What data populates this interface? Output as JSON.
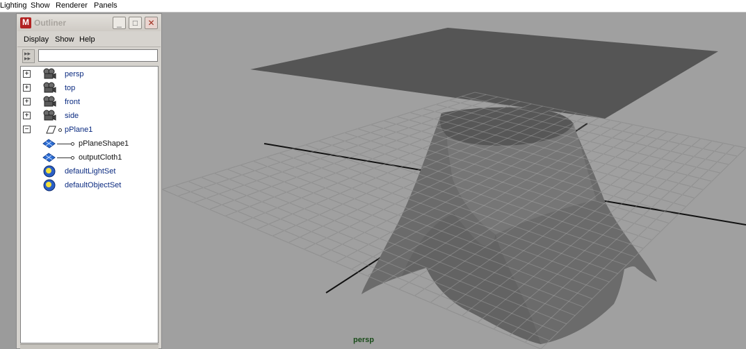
{
  "menubar": {
    "items": [
      "Lighting",
      "Show",
      "Renderer",
      "Panels"
    ]
  },
  "outliner": {
    "title": "Outliner",
    "menu": [
      "Display",
      "Show",
      "Help"
    ],
    "filter_value": "",
    "buttons": {
      "minimize": "_",
      "maximize": "□",
      "close": "✕"
    },
    "tree": [
      {
        "label": "persp",
        "kind": "camera",
        "expander": "+"
      },
      {
        "label": "top",
        "kind": "camera",
        "expander": "+"
      },
      {
        "label": "front",
        "kind": "camera",
        "expander": "+"
      },
      {
        "label": "side",
        "kind": "camera",
        "expander": "+"
      },
      {
        "label": "pPlane1",
        "kind": "transform",
        "expander": "−"
      },
      {
        "label": "pPlaneShape1",
        "kind": "mesh-shape",
        "expander": ""
      },
      {
        "label": "outputCloth1",
        "kind": "mesh-shape",
        "expander": ""
      },
      {
        "label": "defaultLightSet",
        "kind": "set",
        "expander": ""
      },
      {
        "label": "defaultObjectSet",
        "kind": "set",
        "expander": ""
      }
    ]
  },
  "viewport": {
    "camera_label": "persp",
    "colors": {
      "background": "#a0a0a0",
      "grid": "#7c7c7c",
      "axis": "#111111",
      "plane": "#555555",
      "cloth": "#6e6e6e"
    }
  }
}
